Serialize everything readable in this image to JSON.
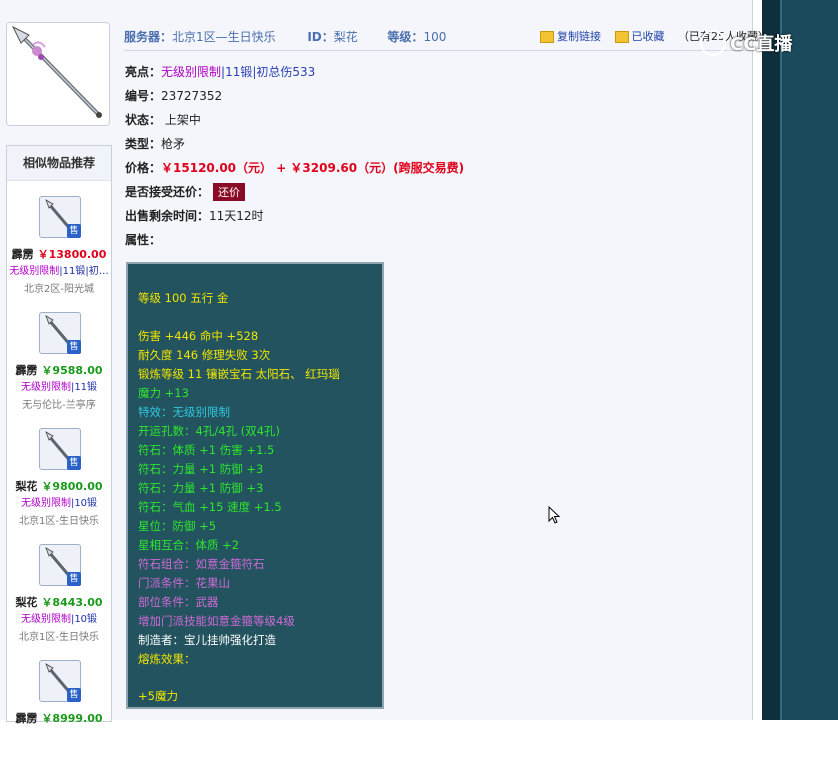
{
  "watermark": "CC直播",
  "header": {
    "server_label": "服务器：",
    "server_value": "北京1区—生日快乐",
    "id_label": "ID：",
    "id_value": "梨花",
    "level_label": "等级：",
    "level_value": "100",
    "copy_link": "复制链接",
    "favorited": "已收藏",
    "fav_count": "（已有25人收藏）"
  },
  "details": {
    "highlight_label": "亮点：",
    "highlight_tags": [
      "无级别限制",
      "11锻",
      "初总伤533"
    ],
    "sep": "|",
    "number_label": "编号：",
    "number_value": "23727352",
    "status_label": "状态：",
    "status_value": "上架中",
    "type_label": "类型：",
    "type_value": "枪矛",
    "price_label": "价格：",
    "price_value": "￥15120.00（元） + ￥3209.60（元）(跨服交易费)",
    "counter_label": "是否接受还价：",
    "counter_button": "还价",
    "remaining_label": "出售剩余时间：",
    "remaining_value": "11天12时",
    "attrs_label": "属性："
  },
  "sidebar": {
    "title": "相似物品推荐",
    "sale_badge": "售",
    "items": [
      {
        "seller": "霹雳",
        "price": "￥13800.00",
        "price_color": "red",
        "tag1": "无级别限制",
        "tag2": "|11锻|初…",
        "server": "北京2区-阳光城"
      },
      {
        "seller": "霹雳",
        "price": "￥9588.00",
        "price_color": "green",
        "tag1": "无级别限制",
        "tag2": "|11锻",
        "server": "无与伦比-兰亭序"
      },
      {
        "seller": "梨花",
        "price": "￥9800.00",
        "price_color": "green",
        "tag1": "无级别限制",
        "tag2": "|10锻",
        "server": "北京1区-生日快乐"
      },
      {
        "seller": "梨花",
        "price": "￥8443.00",
        "price_color": "green",
        "tag1": "无级别限制",
        "tag2": "|10锻",
        "server": "北京1区-生日快乐"
      },
      {
        "seller": "霹雳",
        "price": "￥8999.00",
        "price_color": "green",
        "tag1": "",
        "tag2": "",
        "server": ""
      }
    ]
  },
  "attributes": [
    {
      "text": "等级 100 五行 金",
      "color": "yellow"
    },
    {
      "text": "伤害 +446 命中 +528",
      "color": "yellow"
    },
    {
      "text": "耐久度 146 修理失败 3次",
      "color": "yellow"
    },
    {
      "text": "锻炼等级 11 镶嵌宝石 太阳石、 红玛瑙",
      "color": "yellow"
    },
    {
      "text": "魔力 +13",
      "color": "green"
    },
    {
      "text": "特效：无级别限制",
      "color": "cyan"
    },
    {
      "text": "开运孔数：4孔/4孔 (双4孔)",
      "color": "green"
    },
    {
      "text": "符石：体质 +1 伤害 +1.5",
      "color": "green"
    },
    {
      "text": "符石：力量 +1 防御 +3",
      "color": "green"
    },
    {
      "text": "符石：力量 +1 防御 +3",
      "color": "green"
    },
    {
      "text": "符石：气血 +15 速度 +1.5",
      "color": "green"
    },
    {
      "text": "星位：防御 +5",
      "color": "green"
    },
    {
      "text": "星相互合：体质 +2",
      "color": "green"
    },
    {
      "text": "符石组合：如意金箍符石",
      "color": "purple"
    },
    {
      "text": "门派条件：花果山",
      "color": "purple"
    },
    {
      "text": "部位条件：武器",
      "color": "purple"
    },
    {
      "text": "增加门派技能如意金箍等级4级",
      "color": "purple"
    },
    {
      "text": "制造者：宝儿挂帅强化打造",
      "color": "white"
    },
    {
      "text": "熔炼效果：",
      "color": "yellow"
    },
    {
      "text": "+5魔力",
      "color": "yellow"
    }
  ]
}
